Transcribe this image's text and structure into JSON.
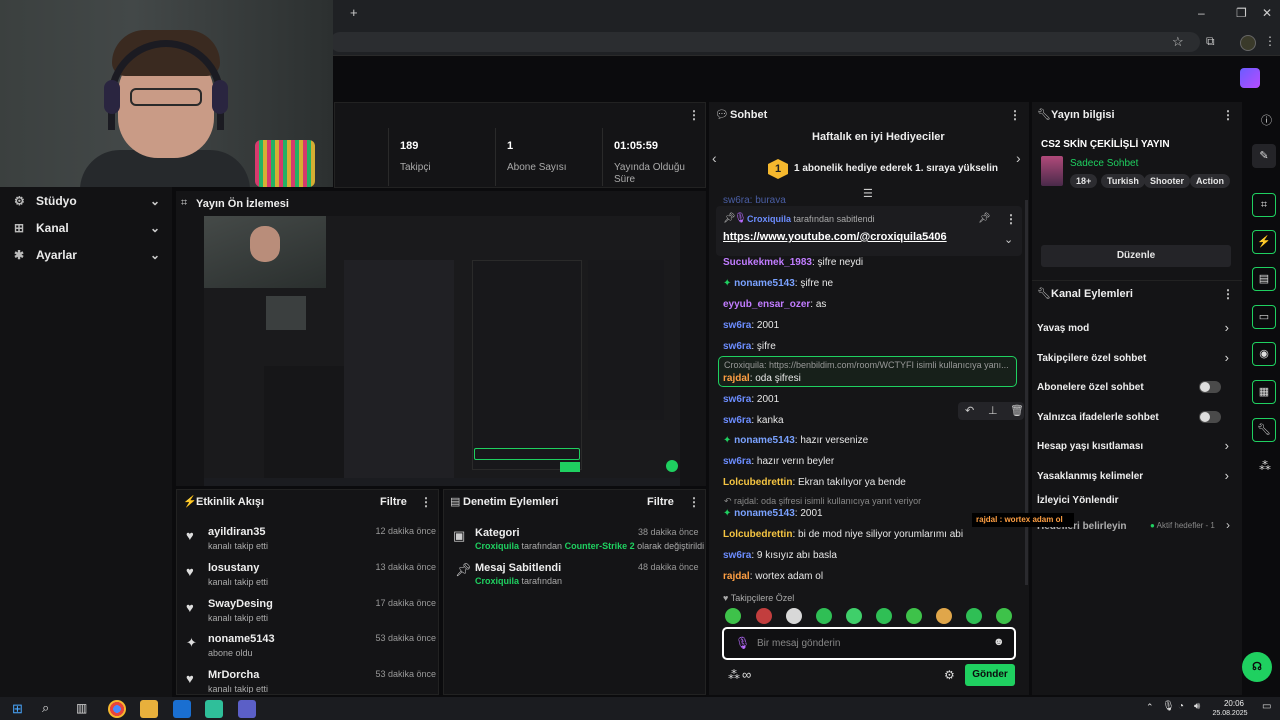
{
  "browser": {
    "new_tab_glyph": "+",
    "window_controls": [
      "–",
      "❐",
      "✕"
    ]
  },
  "sidebar": {
    "items": [
      {
        "label": "Stüdyo",
        "icon": "studio-icon"
      },
      {
        "label": "Kanal",
        "icon": "channel-icon"
      },
      {
        "label": "Ayarlar",
        "icon": "settings-icon"
      }
    ]
  },
  "stats": [
    {
      "value": "189",
      "label": "Takipçi"
    },
    {
      "value": "1",
      "label": "Abone Sayısı"
    },
    {
      "value": "01:05:59",
      "label": "Yayında Olduğu Süre"
    }
  ],
  "preview": {
    "title": "Yayın Ön İzlemesi"
  },
  "activity": {
    "title": "Etkinlik Akışı",
    "filter": "Filtre",
    "items": [
      {
        "name": "ayildiran35",
        "sub": "kanalı takip etti",
        "time": "12 dakika önce",
        "icon": "heart-icon"
      },
      {
        "name": "losustany",
        "sub": "kanalı takip etti",
        "time": "13 dakika önce",
        "icon": "heart-icon"
      },
      {
        "name": "SwayDesing",
        "sub": "kanalı takip etti",
        "time": "17 dakika önce",
        "icon": "heart-icon"
      },
      {
        "name": "noname5143",
        "sub": "abone oldu",
        "time": "53 dakika önce",
        "icon": "sparkle-icon"
      },
      {
        "name": "MrDorcha",
        "sub": "kanalı takip etti",
        "time": "53 dakika önce",
        "icon": "heart-icon"
      }
    ]
  },
  "moderation": {
    "title": "Denetim Eylemleri",
    "filter": "Filtre",
    "items": [
      {
        "title": "Kategori",
        "user": "Croxiquila",
        "middle": "tarafından",
        "target": "Counter-Strike 2",
        "end": "olarak değiştirildi",
        "time": "38 dakika önce"
      },
      {
        "title": "Mesaj Sabitlendi",
        "user": "Croxiquila",
        "middle": "tarafından",
        "target": "",
        "end": "",
        "time": "48 dakika önce"
      }
    ]
  },
  "chat": {
    "title": "Sohbet",
    "gifters_title": "Haftalık en iyi Hediyeciler",
    "gifter_rank": "1",
    "gifter_text": "1 abonelik hediye ederek 1. sıraya yükselin",
    "pinned_by_user": "Croxiquila",
    "pinned_by_text": "tarafından sabitlendi",
    "pinned_link": "https://www.youtube.com/@croxiquila5406",
    "cut_line": "sw6ra: buraya",
    "messages": [
      {
        "user": "Sucukekmek_1983",
        "text": "şifre neydi",
        "color": "#c17cff",
        "badge": false
      },
      {
        "user": "noname5143",
        "text": "şifre ne",
        "color": "#7aa2ff",
        "badge": true
      },
      {
        "user": "eyyub_ensar_ozer",
        "text": "as",
        "color": "#c17cff",
        "badge": false
      },
      {
        "user": "sw6ra",
        "text": "2001",
        "color": "#6c8dff",
        "badge": false
      },
      {
        "user": "sw6ra",
        "text": "şifre",
        "color": "#6c8dff",
        "badge": false
      }
    ],
    "reply_block": {
      "quote": "Croxiquila: https://benbildim.com/room/WCTYFI isimli kullanıcıya yanı...",
      "user": "rajdal",
      "text": "oda şifresi"
    },
    "messages2": [
      {
        "user": "sw6ra",
        "text": "2001",
        "color": "#6c8dff",
        "badge": false
      },
      {
        "user": "sw6ra",
        "text": "kanka",
        "color": "#6c8dff",
        "badge": false
      },
      {
        "user": "noname5143",
        "text": "hazır versenize",
        "color": "#7aa2ff",
        "badge": true
      },
      {
        "user": "sw6ra",
        "text": "hazır verın beyler",
        "color": "#6c8dff",
        "badge": false
      },
      {
        "user": "Lolcubedrettin",
        "text": "Ekran takılıyor ya bende",
        "color": "#f5c542",
        "badge": false
      }
    ],
    "reply2_quote": "rajdal: oda şifresi isimli kullanıcıya yanıt veriyor",
    "messages3": [
      {
        "user": "noname5143",
        "text": "2001",
        "color": "#7aa2ff",
        "badge": true
      },
      {
        "user": "Lolcubedrettin",
        "text": "bi de mod niye siliyor yorumlarımı abi",
        "color": "#f5c542",
        "badge": false
      },
      {
        "user": "sw6ra",
        "text": "9 kısıyız abı basla",
        "color": "#6c8dff",
        "badge": false
      },
      {
        "user": "rajdal",
        "text": "wortex adam ol",
        "color": "#ff9f43",
        "badge": false
      }
    ],
    "emote_label": "Takipçilere Özel",
    "input_placeholder": "Bir mesaj gönderin",
    "infinity": "∞",
    "send_label": "Gönder"
  },
  "stream_info": {
    "title": "Yayın bilgisi",
    "stream_title": "CS2 SKİN ÇEKİLİŞLİ YAYIN",
    "mode": "Sadece Sohbet",
    "tags": [
      "18+",
      "Turkish",
      "Shooter",
      "Action"
    ],
    "edit_label": "Düzenle"
  },
  "channel_actions": {
    "title": "Kanal Eylemleri",
    "items": [
      {
        "label": "Yavaş mod",
        "control": "chevron"
      },
      {
        "label": "Takipçilere özel sohbet",
        "control": "chevron"
      },
      {
        "label": "Abonelere özel sohbet",
        "control": "toggle"
      },
      {
        "label": "Yalnızca ifadelerle sohbet",
        "control": "toggle"
      },
      {
        "label": "Hesap yaşı kısıtlaması",
        "control": "chevron"
      },
      {
        "label": "Yasaklanmış kelimeler",
        "control": "chevron"
      }
    ],
    "viewer_redirect": "İzleyici Yönlendir",
    "goals_label": "Hedefleri belirleyin",
    "active_goals": "Aktif hedefler - 1",
    "overlay_message": "rajdal : wortex adam ol"
  },
  "taskbar": {
    "time": "20:06",
    "date": "25.08.2025"
  },
  "colors": {
    "accent": "#1fd060",
    "background": "#0b0b0d",
    "panel": "#141416"
  }
}
